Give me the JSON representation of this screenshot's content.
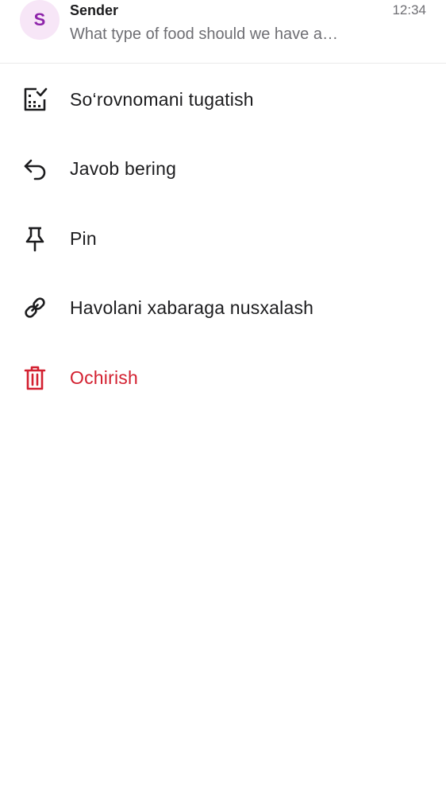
{
  "header": {
    "avatar_letter": "S",
    "sender": "Sender",
    "preview": "What type of food should we have a…",
    "time": "12:34"
  },
  "menu": {
    "items": [
      {
        "label": "So‘rovnomani tugatish",
        "icon": "poll-stop-icon"
      },
      {
        "label": "Javob bering",
        "icon": "reply-icon"
      },
      {
        "label": "Pin",
        "icon": "pin-icon"
      },
      {
        "label": "Havolani xabaraga nusxalash",
        "icon": "link-icon"
      },
      {
        "label": "Ochirish",
        "icon": "trash-icon"
      }
    ]
  },
  "colors": {
    "danger": "#d32030",
    "avatar_bg": "#f7e6f7",
    "avatar_text": "#8e24aa",
    "text_primary": "#1c1c1e",
    "text_secondary": "#6e6e73"
  }
}
